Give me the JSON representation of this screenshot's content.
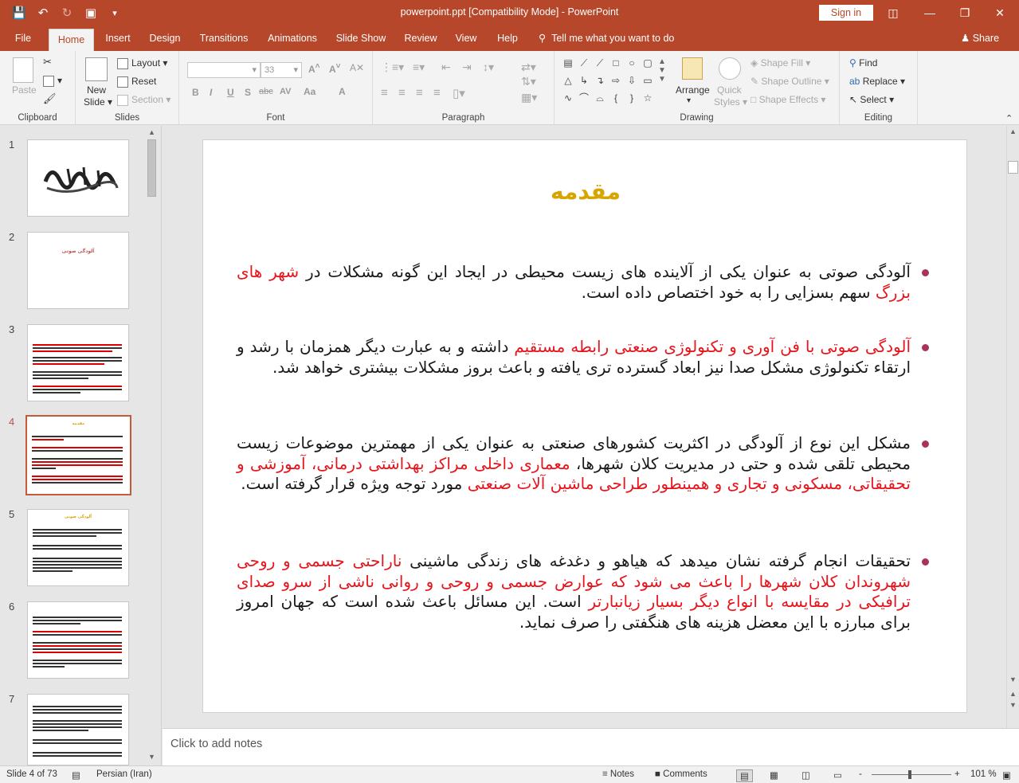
{
  "window": {
    "title": "powerpoint.ppt [Compatibility Mode]  -  PowerPoint",
    "signin_label": "Sign in"
  },
  "tabs": [
    "File",
    "Home",
    "Insert",
    "Design",
    "Transitions",
    "Animations",
    "Slide Show",
    "Review",
    "View",
    "Help"
  ],
  "active_tab": "Home",
  "tellme": "Tell me what you want to do",
  "share_label": "Share",
  "ribbon": {
    "clipboard": {
      "paste": "Paste",
      "label": "Clipboard"
    },
    "slides": {
      "new_slide_1": "New",
      "new_slide_2": "Slide",
      "layout": "Layout",
      "reset": "Reset",
      "section": "Section",
      "label": "Slides"
    },
    "font": {
      "size": "33",
      "label": "Font",
      "bold": "B",
      "italic": "I",
      "underline": "U",
      "shadow": "S",
      "strike": "abc",
      "spacing": "AV",
      "case": "Aa",
      "color": "A"
    },
    "paragraph": {
      "label": "Paragraph"
    },
    "drawing": {
      "arrange": "Arrange",
      "quick_styles_1": "Quick",
      "quick_styles_2": "Styles",
      "shape_fill": "Shape Fill",
      "shape_outline": "Shape Outline",
      "shape_effects": "Shape Effects",
      "label": "Drawing"
    },
    "editing": {
      "find": "Find",
      "replace": "Replace",
      "select": "Select",
      "label": "Editing"
    }
  },
  "thumbnails": [
    "1",
    "2",
    "3",
    "4",
    "5",
    "6",
    "7"
  ],
  "active_slide": "4",
  "thumb_text": {
    "slide2_title": "آلودگی صوتی",
    "slide4_title": "مقدمه",
    "slide5_title": "آلودگی صوتی"
  },
  "slide": {
    "title": "مقدمه",
    "b1_black1": "آلودگی صوتی  به عنوان یکی از آلاینده های زیست محیطی در ایجاد این گونه مشکلات در ",
    "b1_red1": "شهر های بزرگ",
    "b1_black2": " سهم بسزایی را به خود اختصاص داده است.",
    "b2_red1": "آلودگی صوتی با فن آوری و تکنولوژی صنعتی رابطه مستقیم",
    "b2_black1": " داشته  و به عبارت دیگر همزمان با رشد و ارتقاء تکنولوژی مشکل صدا نیز ابعاد گسترده تری یافته و باعث بروز مشکلات بیشتری خواهد شد.",
    "b3_black1": "مشکل این نوع از آلودگی در اکثریت کشورهای صنعتی به عنوان یکی از مهمترین موضوعات زیست محیطی تلقی شده و حتی در مدیریت کلان شهرها، ",
    "b3_red1": "معماری داخلی مراکز بهداشتی درمانی، آموزشی و تحقیقاتی، مسکونی و تجاری و همینطور طراحی ماشین آلات صنعتی",
    "b3_black2": " مورد توجه ویژه قرار گرفته است.",
    "b4_black1": " تحقیقات انجام گرفته نشان میدهد که هیاهو و دغدغه های زندگی ماشینی ",
    "b4_red1": "ناراحتی جسمی و روحی شهروندان کلان شهرها را باعث می شود که عوارض جسمی و روحی و روانی ناشی از سرو صدای ترافیکی در مقایسه با انواع دیگر بسیار زیانبارتر",
    "b4_black2": " است. این مسائل باعث شده است که جهان امروز برای مبارزه با این معضل هزینه های هنگفتی را صرف نماید."
  },
  "notes_placeholder": "Click to add notes",
  "status": {
    "slide_of": "Slide 4 of 73",
    "language": "Persian (Iran)",
    "notes": "Notes",
    "comments": "Comments",
    "zoom": "101 %",
    "zoom_minus": "-",
    "zoom_plus": "+"
  },
  "colors": {
    "accent": "#b7472a",
    "title_gold": "#d7a500",
    "emphasis_red": "#e8141b",
    "bullet": "#a8325a"
  }
}
